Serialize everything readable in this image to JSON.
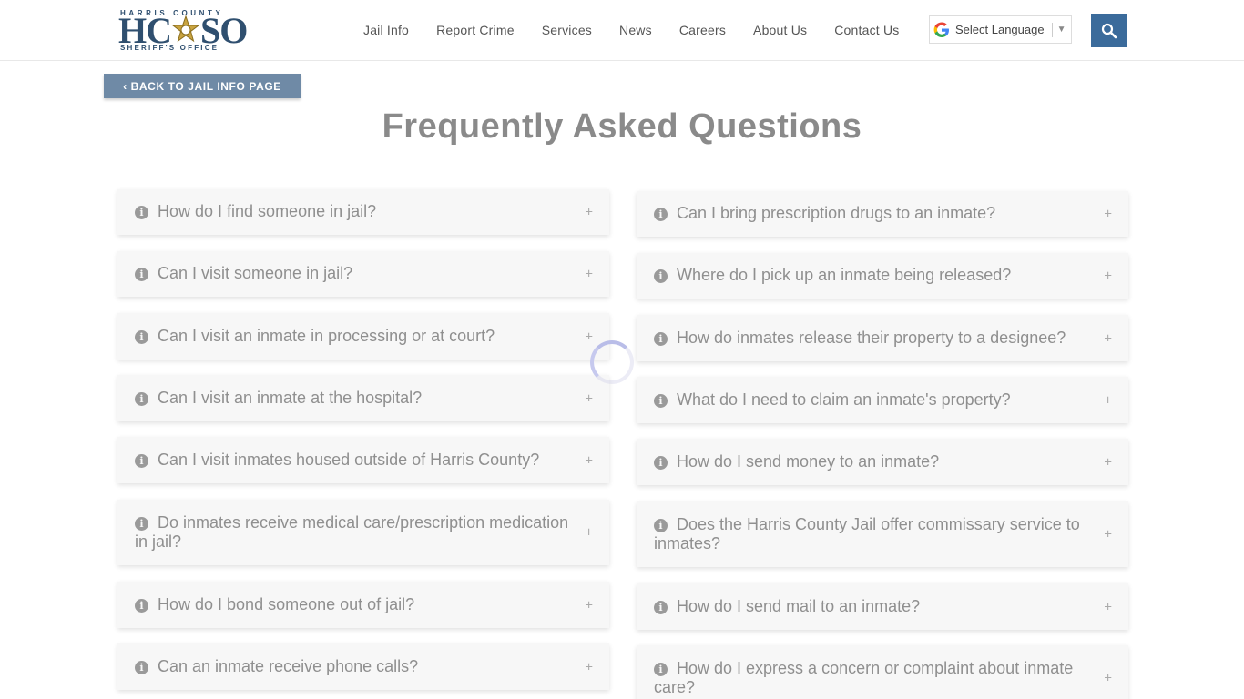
{
  "logo": {
    "top": "HARRIS COUNTY",
    "left": "HC",
    "right": "SO",
    "bottom": "SHERIFF'S OFFICE"
  },
  "nav": [
    "Jail Info",
    "Report Crime",
    "Services",
    "News",
    "Careers",
    "About Us",
    "Contact Us"
  ],
  "language": {
    "label": "Select Language",
    "arrow": "▼"
  },
  "search_icon": "search-icon",
  "back_button": "‹ BACK TO JAIL INFO PAGE",
  "page_title": "Frequently Asked Questions",
  "faq_left": [
    "How do I find someone in jail?",
    "Can I visit someone in jail?",
    "Can I visit an inmate in processing or at court?",
    "Can I visit an inmate at the hospital?",
    "Can I visit inmates housed outside of Harris County?",
    "Do inmates receive medical care/prescription medication in jail?",
    "How do I bond someone out of jail?",
    "Can an inmate receive phone calls?"
  ],
  "faq_right": [
    "Can I bring prescription drugs to an inmate?",
    "Where do I pick up an inmate being released?",
    "How do inmates release their property to a designee?",
    "What do I need to claim an inmate's property?",
    "How do I send money to an inmate?",
    "Does the Harris County Jail offer commissary service to inmates?",
    "How do I send mail to an inmate?",
    "How do I express a concern or complaint about inmate care?"
  ],
  "expand_symbol": "+",
  "info_symbol": "i",
  "colors": {
    "accent": "#3b6b9b",
    "back_button": "#6f8aa6",
    "card_bg": "#f7f7f7",
    "text_muted": "#8f8f8f"
  }
}
